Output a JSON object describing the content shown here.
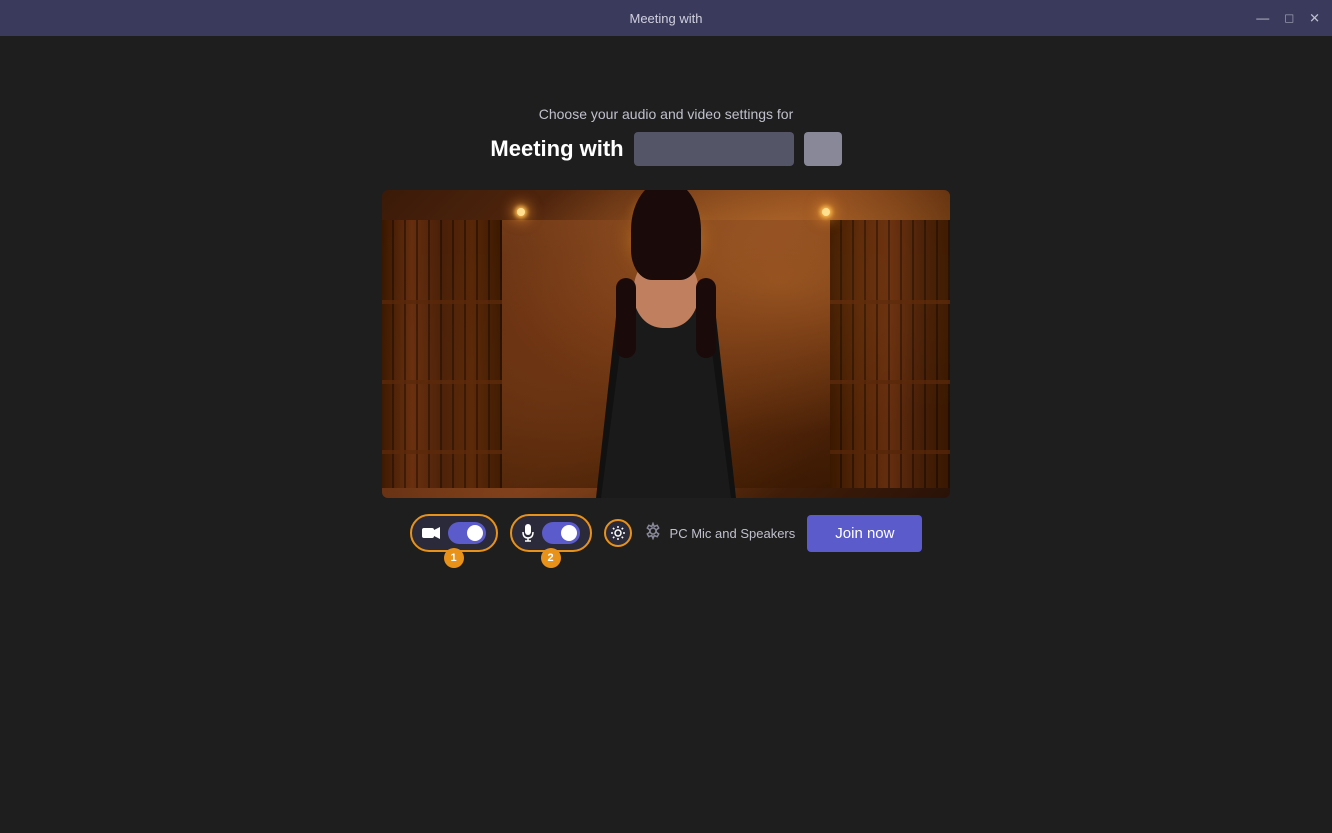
{
  "titleBar": {
    "title": "Meeting with",
    "minimizeLabel": "—",
    "maximizeLabel": "□",
    "closeLabel": "✕"
  },
  "header": {
    "subtitle": "Choose your audio and video settings for",
    "meetingLabel": "Meeting with",
    "nameRedacted": true
  },
  "controls": {
    "videoToggle": true,
    "audioToggle": true,
    "badge1": "1",
    "badge2": "2",
    "speakerLabel": "PC Mic and Speakers",
    "joinNowLabel": "Join now"
  }
}
